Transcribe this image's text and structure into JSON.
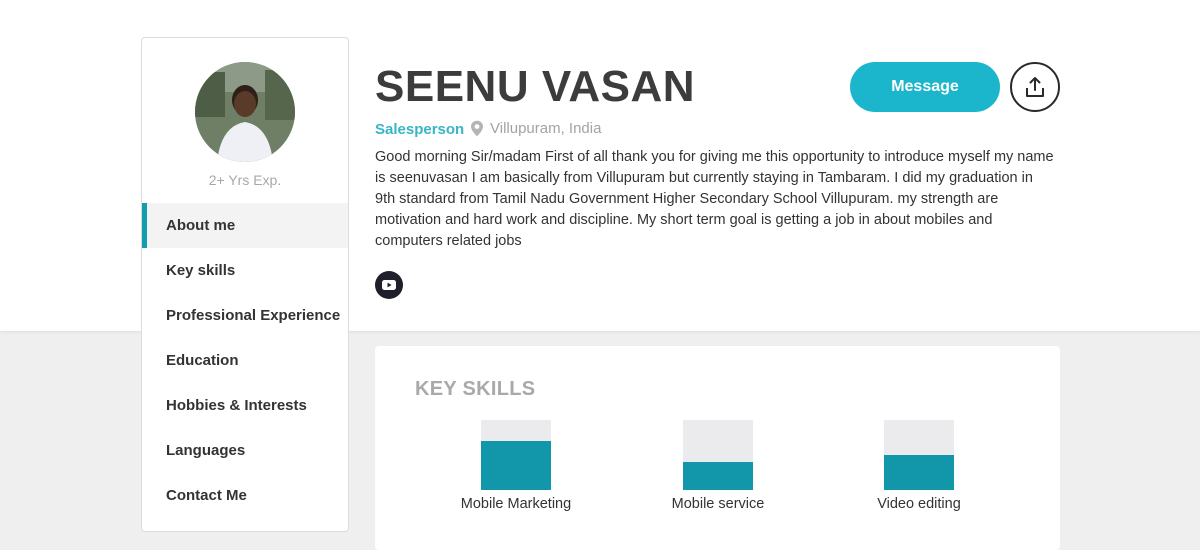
{
  "profile": {
    "name": "SEENU VASAN",
    "role": "Salesperson",
    "location": "Villupuram, India",
    "experience": "2+ Yrs Exp.",
    "about": "Good morning Sir/madam First of all thank you for giving me this opportunity to introduce myself my name is seenuvasan I am basically from Villupuram but currently staying in Tambaram. I did my graduation in 9th standard from Tamil Nadu Government Higher Secondary School Villupuram. my strength are motivation and hard work and discipline. My short term goal is getting a job in about mobiles and computers related jobs"
  },
  "actions": {
    "message_label": "Message",
    "share_icon": "share-upload-icon",
    "youtube_icon": "youtube-icon"
  },
  "nav": {
    "items": [
      {
        "label": "About me",
        "active": true
      },
      {
        "label": "Key skills",
        "active": false
      },
      {
        "label": "Professional Experience",
        "active": false
      },
      {
        "label": "Education",
        "active": false
      },
      {
        "label": "Hobbies & Interests",
        "active": false
      },
      {
        "label": "Languages",
        "active": false
      },
      {
        "label": "Contact Me",
        "active": false
      }
    ]
  },
  "skills": {
    "title": "KEY SKILLS",
    "items": [
      {
        "label": "Mobile Marketing",
        "level": 0.7
      },
      {
        "label": "Mobile service",
        "level": 0.4
      },
      {
        "label": "Video editing",
        "level": 0.5
      }
    ]
  },
  "colors": {
    "accent": "#1bb6cc",
    "skill_bar": "#1196aa",
    "role_text": "#38b6c5",
    "active_nav_border": "#139eb0"
  }
}
